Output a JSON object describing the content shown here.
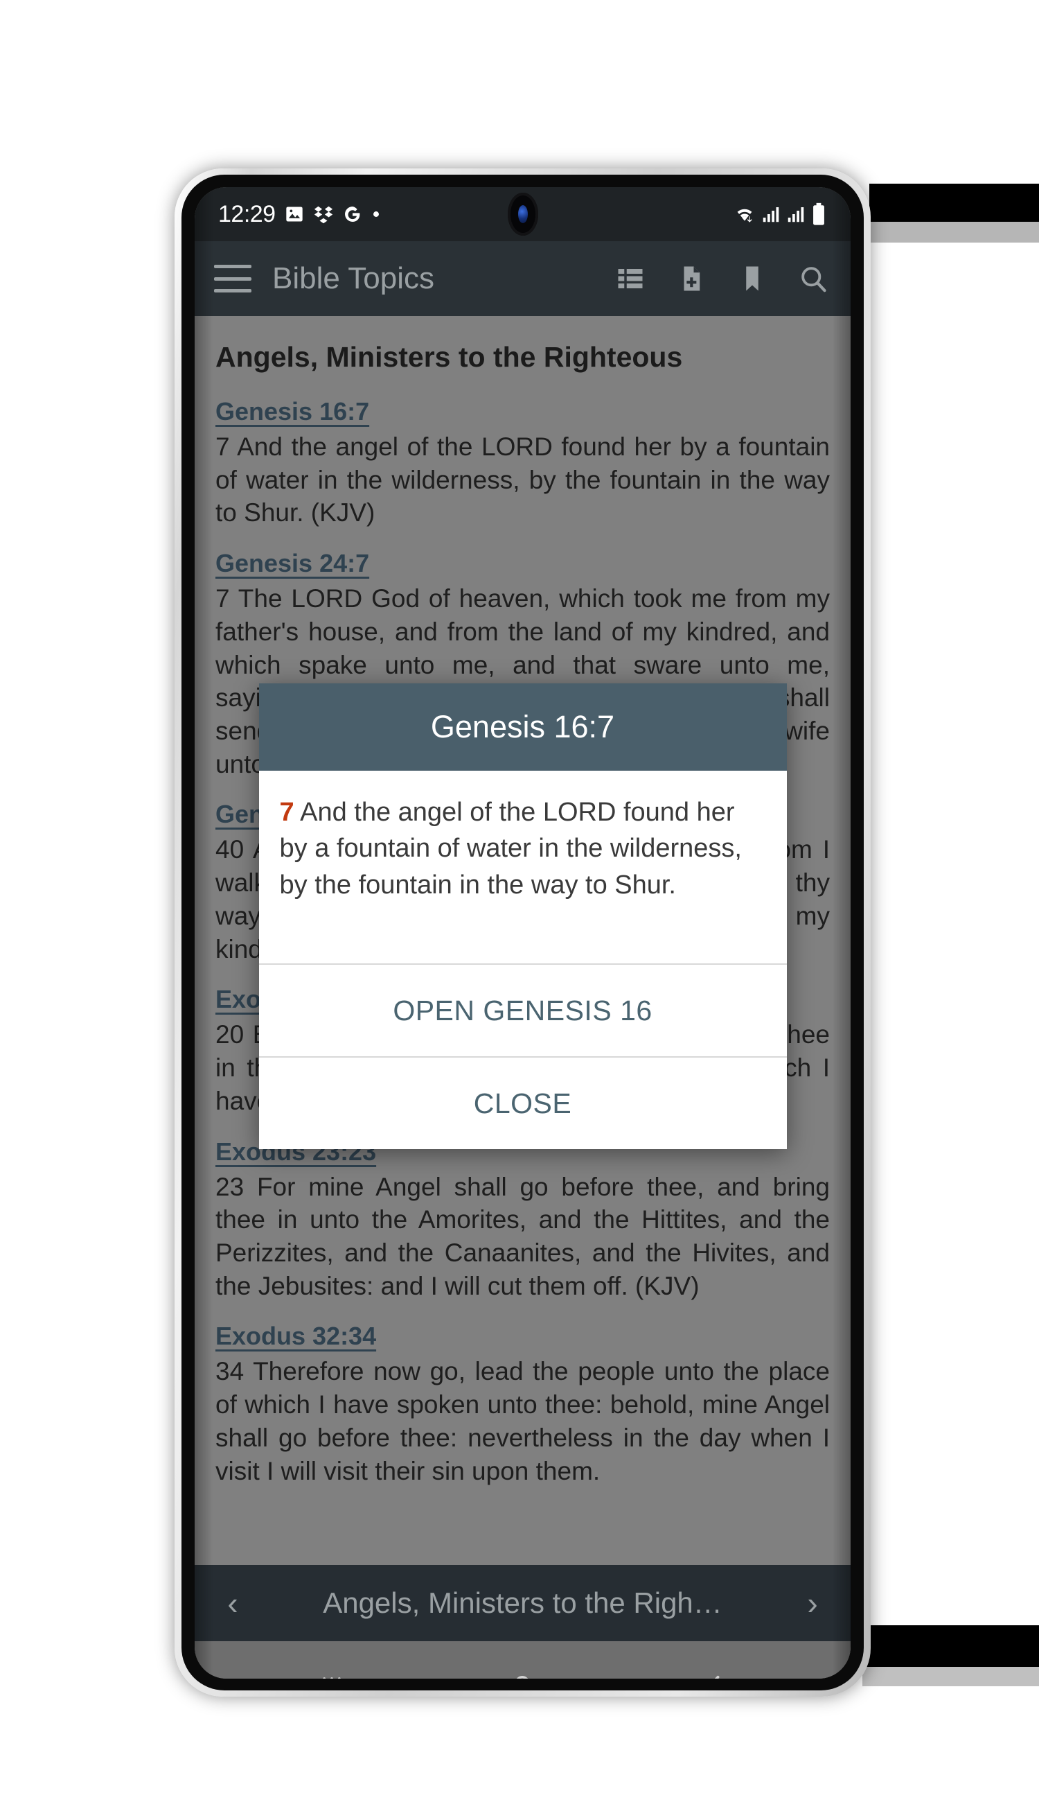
{
  "status_bar": {
    "time": "12:29",
    "left_icons": [
      "image-icon",
      "dropbox-icon",
      "google-icon",
      "dot-icon"
    ],
    "right_icons": [
      "wifi-icon",
      "signal-bars-icon",
      "signal-bars-2-icon",
      "battery-icon"
    ]
  },
  "app_bar": {
    "title": "Bible Topics",
    "menu_icon": "hamburger-menu-icon",
    "actions": [
      {
        "name": "list-view-icon",
        "label": "List"
      },
      {
        "name": "note-add-icon",
        "label": "Add Note"
      },
      {
        "name": "bookmark-icon",
        "label": "Bookmark"
      },
      {
        "name": "search-icon",
        "label": "Search"
      }
    ]
  },
  "content": {
    "topic_title": "Angels, Ministers to the Righteous",
    "verses": [
      {
        "ref": "Genesis 16:7",
        "text": "7 And the angel of the LORD found her by a fountain of water in the wilderness, by the fountain in the way to Shur. (KJV)"
      },
      {
        "ref": "Genesis 24:7",
        "text": "7 The LORD God of heaven, which took me from my father's house, and from the land of my kindred, and which spake unto me, and that sware unto me, saying, Unto thy seed will I give this land; he shall send his angel before thee, and thou shalt take a wife unto my son from thence. (KJV)"
      },
      {
        "ref": "Genesis 24:40",
        "text": "40 And he said unto me, The LORD, before whom I walk, will send his angel with thee, and prosper thy way; and thou shalt take a wife for my son of my kindred, and of my father's house: (KJV)"
      },
      {
        "ref": "Exodus 23:20",
        "text": "20 Behold, I send an Angel before thee, to keep thee in the way, and to bring thee into the place which I have prepared. (KJV)"
      },
      {
        "ref": "Exodus 23:23",
        "text": "23 For mine Angel shall go before thee, and bring thee in unto the Amorites, and the Hittites, and the Perizzites, and the Canaanites, and the Hivites, and the Jebusites: and I will cut them off. (KJV)"
      },
      {
        "ref": "Exodus 32:34",
        "text": "34 Therefore now go, lead the people unto the place of which I have spoken unto thee: behold, mine Angel shall go before thee: nevertheless in the day when I visit I will visit their sin upon them."
      }
    ]
  },
  "dialog": {
    "title": "Genesis 16:7",
    "verse_number": "7",
    "verse_text": " And the angel of the LORD found her by a fountain of water in the wilderness, by the fountain in the way to Shur.",
    "primary_button": "OPEN GENESIS 16",
    "secondary_button": "CLOSE"
  },
  "topic_nav": {
    "prev_icon": "chevron-left-icon",
    "label": "Angels, Ministers to the Righ…",
    "next_icon": "chevron-right-icon"
  },
  "android_nav": {
    "recents_icon": "recents-icon",
    "home_icon": "home-icon",
    "back_icon": "back-icon"
  },
  "colors": {
    "status_bar_bg": "#1f2326",
    "app_bar_bg": "#2a3136",
    "content_bg": "#808080",
    "dialog_header_bg": "#4a5f6b",
    "accent_link": "#2f4250",
    "verse_number": "#c23a10",
    "button_text": "#4a6470",
    "topic_nav_bg": "#262d33",
    "android_nav_bg": "#6e6e6e"
  }
}
